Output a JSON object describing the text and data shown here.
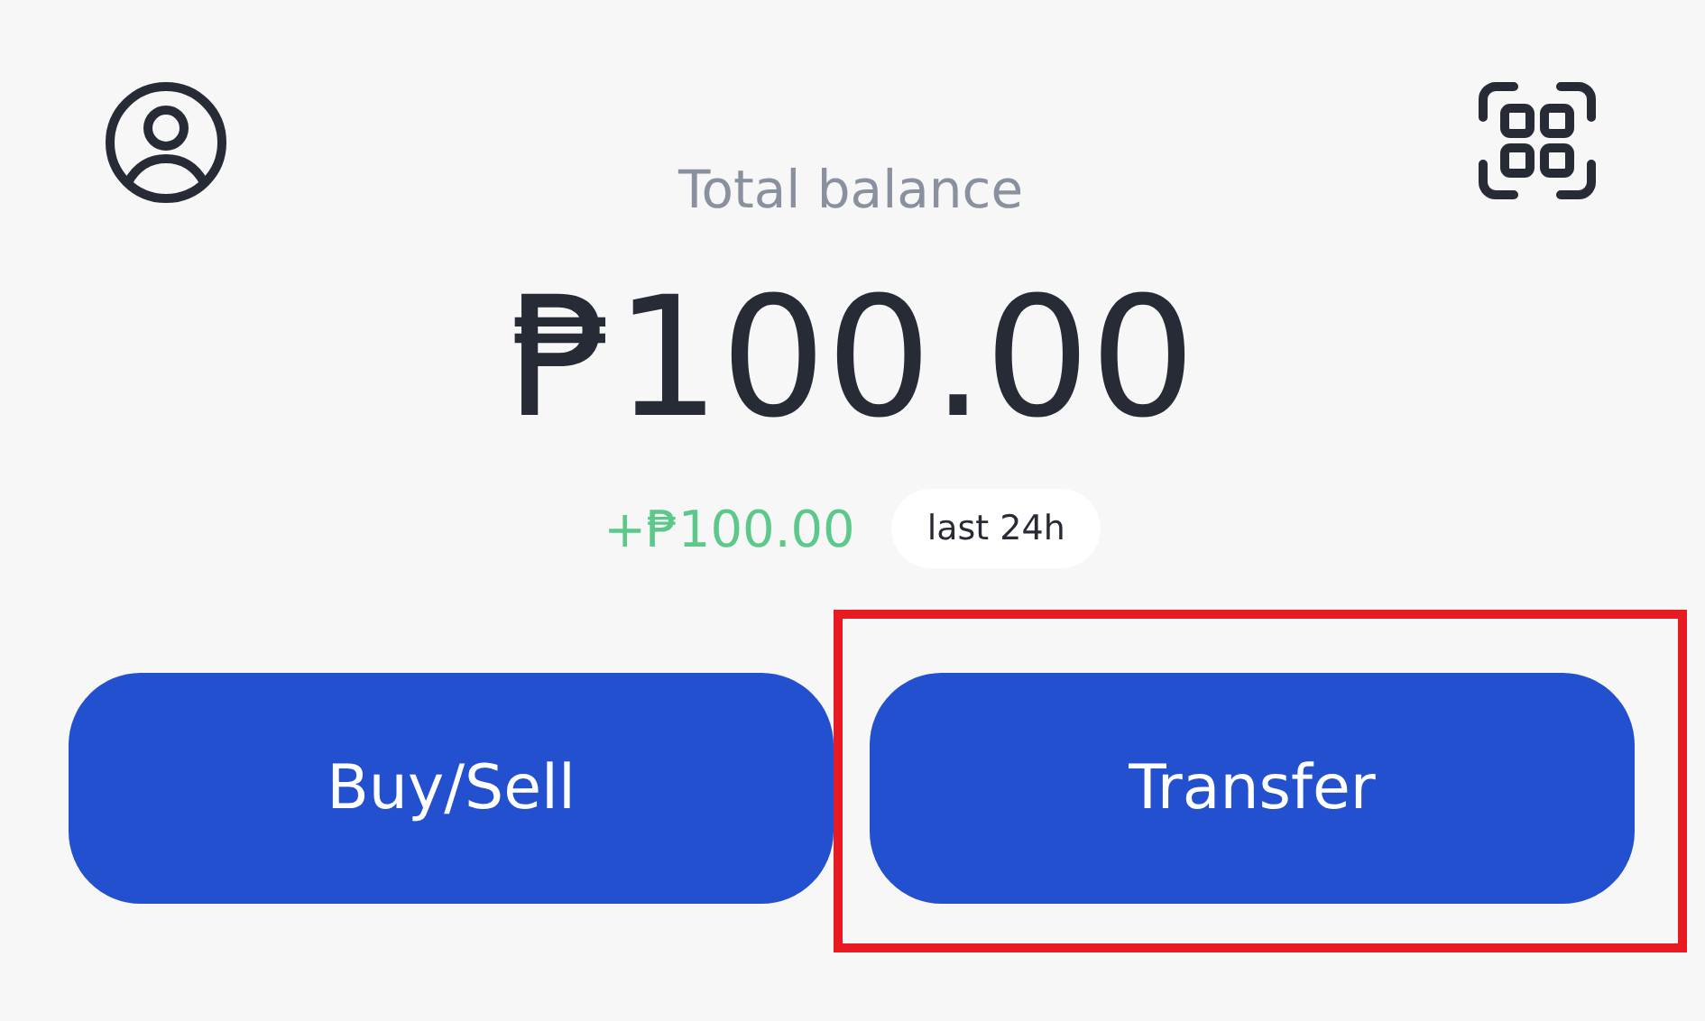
{
  "header": {
    "title": "Total balance"
  },
  "balance": "₱100.00",
  "change": {
    "amount": "+₱100.00",
    "period": "last 24h"
  },
  "buttons": [
    {
      "label": "Buy/Sell",
      "highlighted": false
    },
    {
      "label": "Transfer",
      "highlighted": true
    }
  ]
}
